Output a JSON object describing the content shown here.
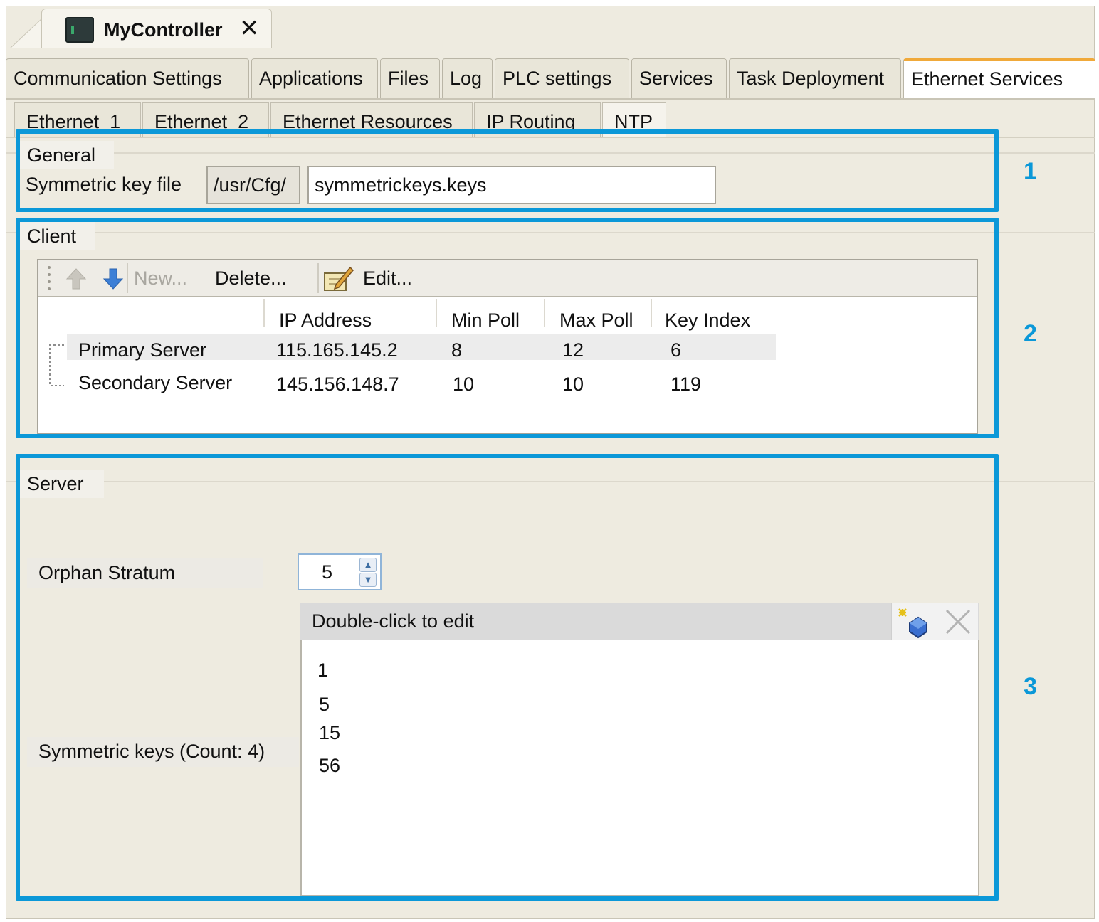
{
  "document_tab": {
    "title": "MyController",
    "close_glyph": "✕",
    "icon": "controller-icon"
  },
  "main_tabs": [
    {
      "label": "Communication Settings",
      "active": false
    },
    {
      "label": "Applications",
      "active": false
    },
    {
      "label": "Files",
      "active": false
    },
    {
      "label": "Log",
      "active": false
    },
    {
      "label": "PLC settings",
      "active": false
    },
    {
      "label": "Services",
      "active": false
    },
    {
      "label": "Task Deployment",
      "active": false
    },
    {
      "label": "Ethernet Services",
      "active": true
    }
  ],
  "sub_tabs": [
    {
      "label": "Ethernet  1",
      "active": false
    },
    {
      "label": "Ethernet  2",
      "active": false
    },
    {
      "label": "Ethernet Resources",
      "active": false
    },
    {
      "label": "IP Routing",
      "active": false
    },
    {
      "label": "NTP",
      "active": true
    }
  ],
  "callouts": [
    "1",
    "2",
    "3"
  ],
  "general": {
    "title": "General",
    "symmetric_key_label": "Symmetric key file",
    "path_prefix": "/usr/Cfg/",
    "file_value": "symmetrickeys.keys"
  },
  "client": {
    "title": "Client",
    "toolbar": {
      "new": "New...",
      "delete": "Delete...",
      "edit": "Edit..."
    },
    "columns": [
      "IP Address",
      "Min Poll",
      "Max Poll",
      "Key Index"
    ],
    "rows": [
      {
        "name": "Primary Server",
        "ip": "115.165.145.2",
        "min_poll": "8",
        "max_poll": "12",
        "key_index": "6"
      },
      {
        "name": "Secondary Server",
        "ip": "145.156.148.7",
        "min_poll": "10",
        "max_poll": "10",
        "key_index": "119"
      }
    ]
  },
  "server": {
    "title": "Server",
    "orphan_label": "Orphan Stratum",
    "orphan_value": "5",
    "keys_label": "Symmetric keys (Count: 4)",
    "keys_header": "Double-click to edit",
    "keys": [
      "1",
      "5",
      "15",
      "56"
    ]
  },
  "colors": {
    "callout_blue": "#0b98d8",
    "active_tab_accent": "#f0a93a",
    "window_bg": "#eeebe0"
  }
}
